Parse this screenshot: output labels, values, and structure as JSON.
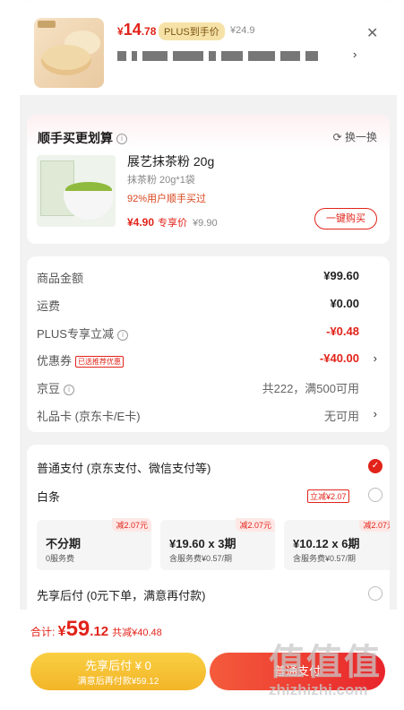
{
  "product": {
    "price_symbol": "¥",
    "price_int": "14",
    "price_dec": ".78",
    "plus_tag": "PLUS到手价",
    "original_price": "¥24.9"
  },
  "recommend": {
    "title": "顺手买更划算",
    "swap_label": "换一换",
    "item": {
      "name": "展艺抹茶粉 20g",
      "spec": "抹茶粉 20g*1袋",
      "social_proof": "92%用户顺手买过",
      "price": "¥4.90",
      "price_label": "专享价",
      "original_price": "¥9.90",
      "buy_button": "一键购买"
    }
  },
  "summary": {
    "rows": [
      {
        "label": "商品金额",
        "value": "¥99.60"
      },
      {
        "label": "运费",
        "value": "¥0.00"
      },
      {
        "label": "PLUS专享立减",
        "value": "-¥0.48"
      },
      {
        "label": "优惠券",
        "tag": "已选推荐优惠",
        "value": "-¥40.00"
      },
      {
        "label": "京豆",
        "value": "共222，满500可用"
      },
      {
        "label": "礼品卡 (京东卡/E卡)",
        "value": "无可用"
      }
    ]
  },
  "payment": {
    "option1": "普通支付 (京东支付、微信支付等)",
    "option2": "白条",
    "baitiao_cut": "立减¥2.07",
    "installments": [
      {
        "tag": "减2.07元",
        "title": "不分期",
        "sub": "0服务费"
      },
      {
        "tag": "减2.07元",
        "title": "¥19.60 x 3期",
        "sub": "含服务费¥0.57/期"
      },
      {
        "tag": "减2.07元",
        "title": "¥10.12 x 6期",
        "sub": "含服务费¥0.57/期"
      }
    ],
    "option3": "先享后付 (0元下单，满意再付款)"
  },
  "bottom": {
    "total_label": "合计: ",
    "total_symbol": "¥",
    "total_int": "59",
    "total_dec": ".12",
    "save_text": "共减¥40.48",
    "later_l1": "先享后付 ¥ 0",
    "later_l2": "满意后再付款¥59.12",
    "pay_button": "普通支付"
  },
  "watermark": {
    "line1": "值值值",
    "line2": "zhizhizhi.com"
  },
  "colors": {
    "accent": "#e2231a",
    "yellow": "#f3b528"
  }
}
